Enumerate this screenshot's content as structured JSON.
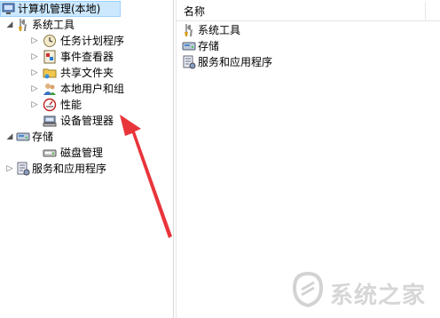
{
  "tree": {
    "root": {
      "label": "计算机管理(本地)",
      "icon": "computer-management-icon"
    },
    "items": [
      {
        "label": "系统工具",
        "icon": "tools-icon",
        "expanded": true
      },
      {
        "label": "任务计划程序",
        "icon": "clock-icon"
      },
      {
        "label": "事件查看器",
        "icon": "event-viewer-icon"
      },
      {
        "label": "共享文件夹",
        "icon": "shared-folder-icon"
      },
      {
        "label": "本地用户和组",
        "icon": "users-icon"
      },
      {
        "label": "性能",
        "icon": "performance-icon"
      },
      {
        "label": "设备管理器",
        "icon": "device-manager-icon"
      },
      {
        "label": "存储",
        "icon": "storage-icon",
        "expanded": true
      },
      {
        "label": "磁盘管理",
        "icon": "disk-management-icon"
      },
      {
        "label": "服务和应用程序",
        "icon": "services-icon"
      }
    ]
  },
  "list": {
    "column_header": "名称",
    "items": [
      {
        "label": "系统工具",
        "icon": "tools-icon"
      },
      {
        "label": "存储",
        "icon": "storage-icon"
      },
      {
        "label": "服务和应用程序",
        "icon": "services-icon"
      }
    ]
  },
  "annotation": {
    "color": "#e8353b"
  },
  "watermark": {
    "text": "系统之家"
  }
}
